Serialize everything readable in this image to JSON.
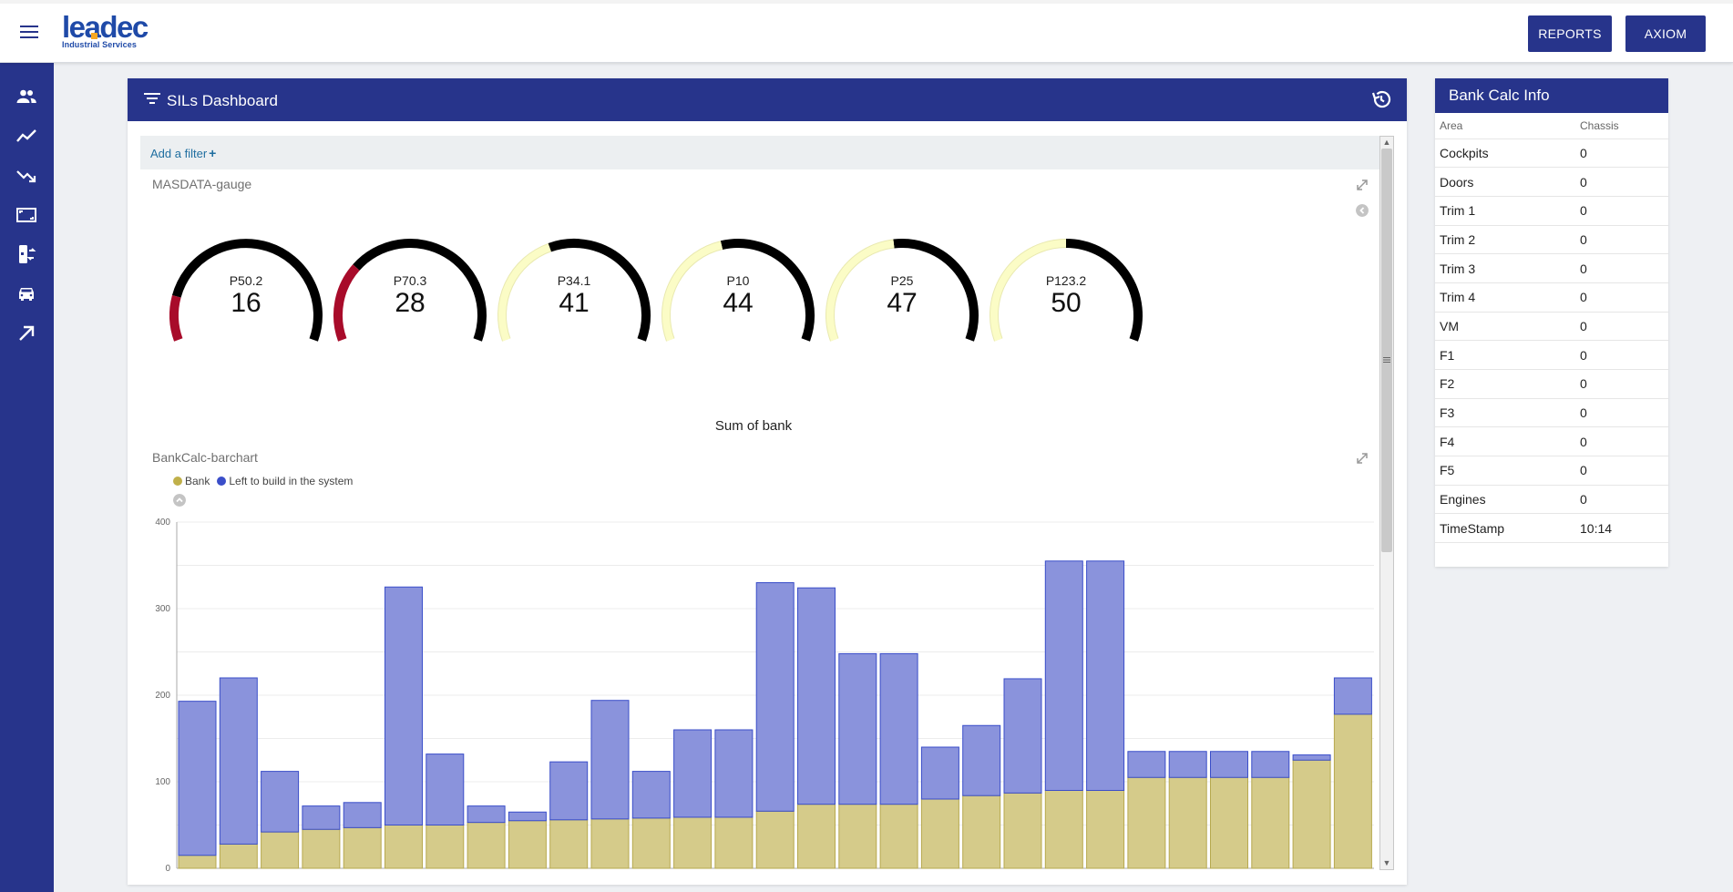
{
  "header": {
    "logo_text": "leadec",
    "logo_subtitle": "Industrial Services",
    "buttons": [
      {
        "label": "REPORTS"
      },
      {
        "label": "AXIOM"
      }
    ]
  },
  "nav": {
    "icons": [
      "people-icon",
      "trending-up-icon",
      "trending-down-icon",
      "aspect-ratio-icon",
      "phone-flip-icon",
      "car-icon",
      "arrow-up-right-icon"
    ]
  },
  "dashboard": {
    "title": "SILs Dashboard",
    "add_filter": "Add a filter",
    "gauge_panel_title": "MASDATA-gauge",
    "gauges": [
      {
        "label": "P50.2",
        "value": "16",
        "fill_fraction": 0.16,
        "color": "#a80b2a"
      },
      {
        "label": "P70.3",
        "value": "28",
        "fill_fraction": 0.28,
        "color": "#a80b2a"
      },
      {
        "label": "P34.1",
        "value": "41",
        "fill_fraction": 0.41,
        "color": "#fbfcc6"
      },
      {
        "label": "P10",
        "value": "44",
        "fill_fraction": 0.44,
        "color": "#fbfcc6"
      },
      {
        "label": "P25",
        "value": "47",
        "fill_fraction": 0.47,
        "color": "#fbfcc6"
      },
      {
        "label": "P123.2",
        "value": "50",
        "fill_fraction": 0.5,
        "color": "#fbfcc6"
      }
    ],
    "chart_title": "Sum of bank",
    "chart_panel_title": "BankCalc-barchart",
    "legend": [
      {
        "name": "Bank",
        "color": "#c0b04a"
      },
      {
        "name": "Left to build in the system",
        "color": "#3a4ec9"
      }
    ]
  },
  "chart_data": {
    "type": "bar",
    "title": "Sum of bank",
    "stacked": true,
    "ylim": [
      0,
      400
    ],
    "yticks": [
      0,
      100,
      200,
      300,
      400
    ],
    "grid": true,
    "legend_position": "top-left",
    "series": [
      {
        "name": "Bank",
        "color": "#d5cb8a",
        "values": [
          15,
          28,
          42,
          45,
          47,
          50,
          50,
          53,
          55,
          56,
          57,
          58,
          59,
          59,
          66,
          74,
          74,
          74,
          80,
          84,
          87,
          90,
          90,
          105,
          105,
          105,
          105,
          125,
          178
        ]
      },
      {
        "name": "Left to build in the system",
        "color": "#8a93dc",
        "values": [
          178,
          192,
          70,
          27,
          29,
          275,
          82,
          19,
          10,
          67,
          137,
          54,
          101,
          101,
          264,
          250,
          174,
          174,
          60,
          81,
          132,
          265,
          265,
          30,
          30,
          30,
          30,
          6,
          42
        ]
      }
    ]
  },
  "bank_info": {
    "title": "Bank Calc Info",
    "columns": [
      "Area",
      "Chassis"
    ],
    "rows": [
      [
        "Cockpits",
        "0"
      ],
      [
        "Doors",
        "0"
      ],
      [
        "Trim 1",
        "0"
      ],
      [
        "Trim 2",
        "0"
      ],
      [
        "Trim 3",
        "0"
      ],
      [
        "Trim 4",
        "0"
      ],
      [
        "VM",
        "0"
      ],
      [
        "F1",
        "0"
      ],
      [
        "F2",
        "0"
      ],
      [
        "F3",
        "0"
      ],
      [
        "F4",
        "0"
      ],
      [
        "F5",
        "0"
      ],
      [
        "Engines",
        "0"
      ],
      [
        "TimeStamp",
        "10:14"
      ]
    ]
  }
}
